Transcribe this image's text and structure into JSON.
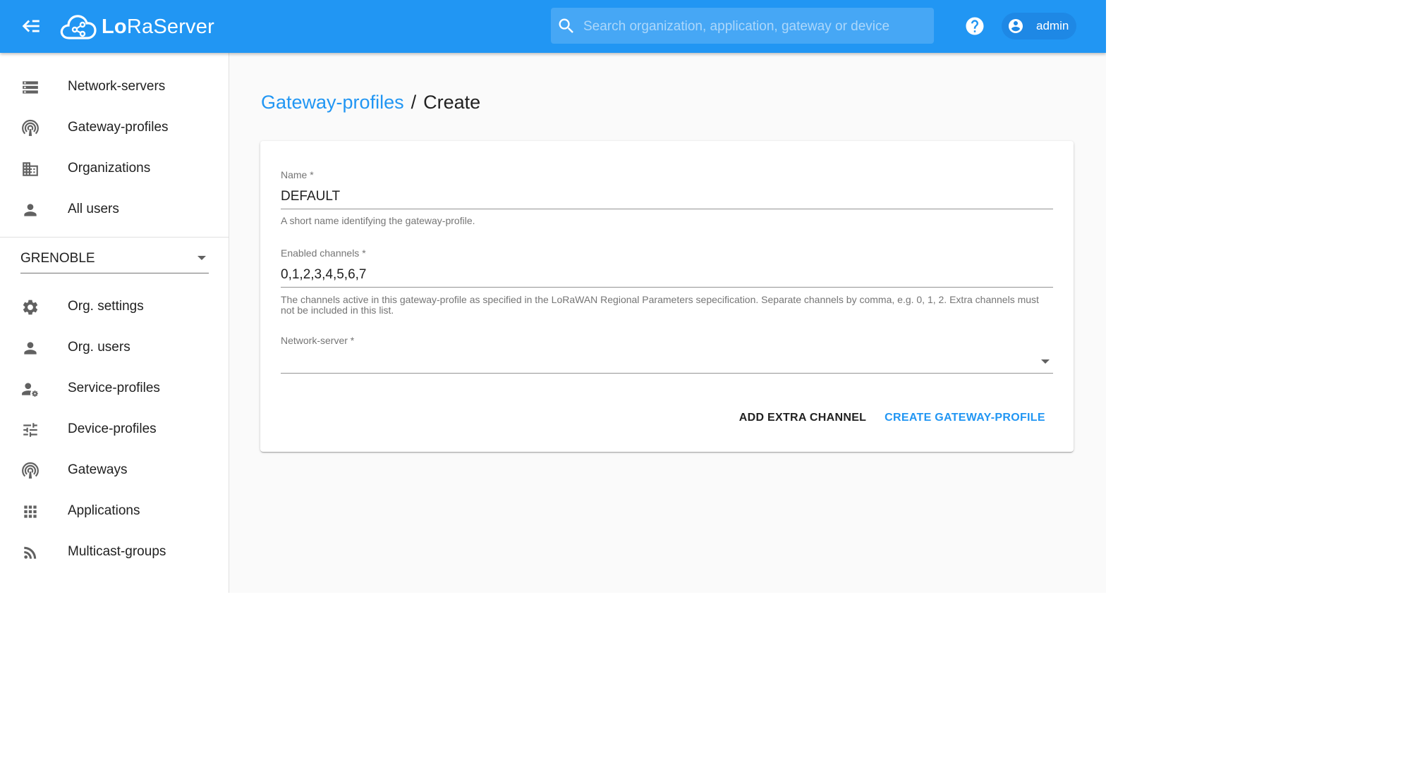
{
  "app": {
    "brand_prefix": "Lo",
    "brand_mid": "Ra",
    "brand_suffix": "Server",
    "accent_color": "#2196f3"
  },
  "header": {
    "search_placeholder": "Search organization, application, gateway or device",
    "search_value": "",
    "user_name": "admin",
    "icons": [
      "menu-collapse-icon",
      "lora-cloud-logo",
      "search-icon",
      "help-icon",
      "account-circle-icon"
    ]
  },
  "sidebar": {
    "global_items": [
      {
        "label": "Network-servers",
        "icon": "server-icon"
      },
      {
        "label": "Gateway-profiles",
        "icon": "broadcast-tower-icon"
      },
      {
        "label": "Organizations",
        "icon": "domain-icon"
      },
      {
        "label": "All users",
        "icon": "account-icon"
      }
    ],
    "organization": {
      "selected": "GRENOBLE"
    },
    "org_items": [
      {
        "label": "Org. settings",
        "icon": "gear-icon"
      },
      {
        "label": "Org. users",
        "icon": "account-icon"
      },
      {
        "label": "Service-profiles",
        "icon": "account-settings-icon"
      },
      {
        "label": "Device-profiles",
        "icon": "tune-icon"
      },
      {
        "label": "Gateways",
        "icon": "broadcast-tower-icon"
      },
      {
        "label": "Applications",
        "icon": "apps-grid-icon"
      },
      {
        "label": "Multicast-groups",
        "icon": "rss-feed-icon"
      }
    ]
  },
  "page": {
    "breadcrumb_parent": "Gateway-profiles",
    "breadcrumb_separator": "/",
    "breadcrumb_current": "Create"
  },
  "form": {
    "name": {
      "label": "Name *",
      "value": "DEFAULT",
      "help": "A short name identifying the gateway-profile."
    },
    "channels": {
      "label": "Enabled channels *",
      "value": "0,1,2,3,4,5,6,7",
      "help": "The channels active in this gateway-profile as specified in the LoRaWAN Regional Parameters sepecification. Separate channels by comma, e.g. 0, 1, 2. Extra channels must not be included in this list."
    },
    "network_server": {
      "label": "Network-server *",
      "value": ""
    },
    "add_extra_channel_label": "ADD EXTRA CHANNEL",
    "create_label": "CREATE GATEWAY-PROFILE"
  }
}
